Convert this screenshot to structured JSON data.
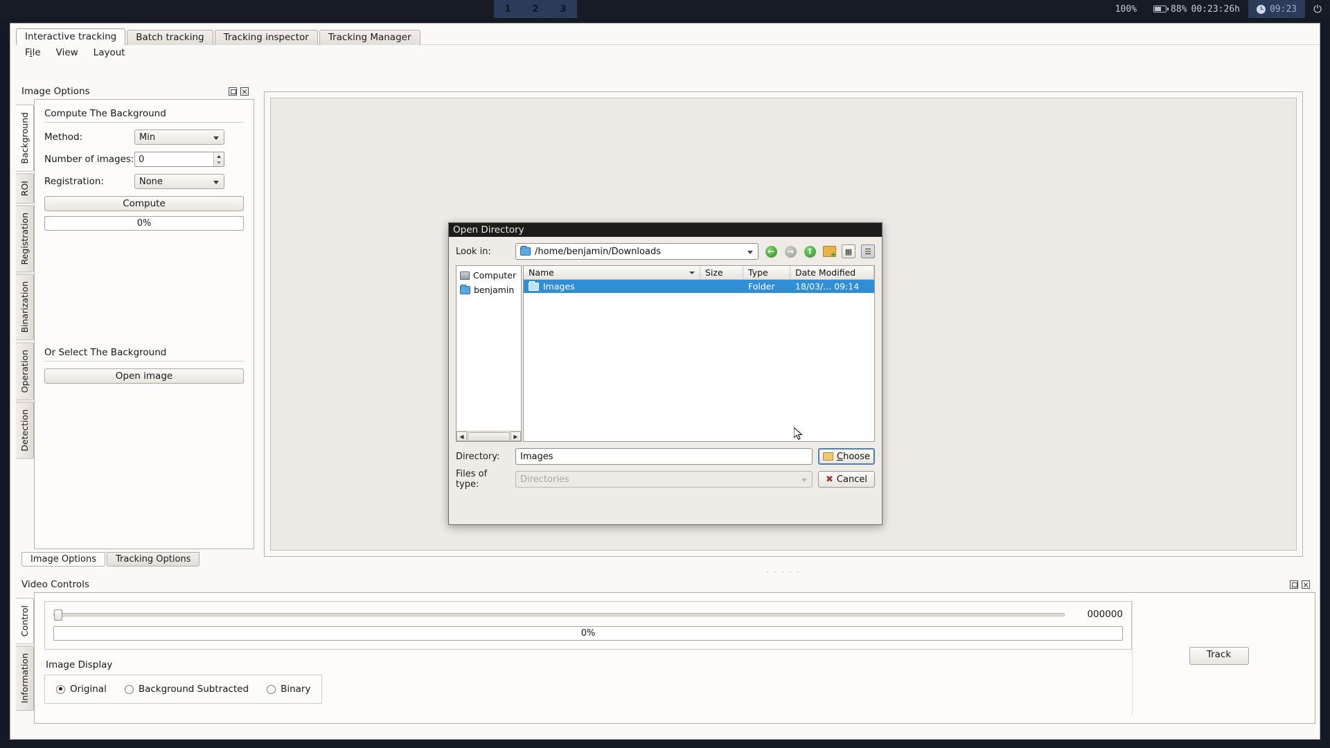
{
  "topbar": {
    "workspaces": [
      "1",
      "2",
      "3"
    ],
    "brightness": "100%",
    "battery_pct": "88%",
    "battery_time": "00:23:26h",
    "clock": "09:23",
    "power_icon": "power-icon"
  },
  "app": {
    "tabs": [
      {
        "label": "Interactive tracking",
        "active": true
      },
      {
        "label": "Batch tracking",
        "active": false
      },
      {
        "label": "Tracking inspector",
        "active": false
      },
      {
        "label": "Tracking Manager",
        "active": false
      }
    ],
    "menu": [
      "File",
      "View",
      "Layout"
    ]
  },
  "image_options": {
    "title": "Image Options",
    "vtabs": [
      {
        "label": "Background",
        "active": true
      },
      {
        "label": "ROI",
        "active": false
      },
      {
        "label": "Registration",
        "active": false
      },
      {
        "label": "Binarization",
        "active": false
      },
      {
        "label": "Operation",
        "active": false
      },
      {
        "label": "Detection",
        "active": false
      }
    ],
    "compute_heading": "Compute The Background",
    "method_label": "Method:",
    "method_value": "Min",
    "num_images_label": "Number of images:",
    "num_images_value": "0",
    "registration_label": "Registration:",
    "registration_value": "None",
    "compute_button": "Compute",
    "progress": "0%",
    "select_heading": "Or Select The Background",
    "open_image_button": "Open image",
    "bottom_tabs": [
      {
        "label": "Image Options",
        "active": true
      },
      {
        "label": "Tracking Options",
        "active": false
      }
    ]
  },
  "video_controls": {
    "title": "Video Controls",
    "vtabs": [
      {
        "label": "Control",
        "active": true
      },
      {
        "label": "Information",
        "active": false
      }
    ],
    "frame_counter": "000000",
    "progress": "0%",
    "image_display_label": "Image Display",
    "display_options": [
      {
        "label": "Original",
        "selected": true
      },
      {
        "label": "Background Subtracted",
        "selected": false
      },
      {
        "label": "Binary",
        "selected": false
      }
    ],
    "track_button": "Track"
  },
  "dialog": {
    "title": "Open Directory",
    "lookin_label": "Look in:",
    "lookin_value": "/home/benjamin/Downloads",
    "nav_icons": [
      "back-icon",
      "forward-icon",
      "parent-directory-icon",
      "new-folder-icon",
      "list-view-icon",
      "detail-view-icon"
    ],
    "sidebar": [
      {
        "label": "Computer",
        "icon": "computer-icon"
      },
      {
        "label": "benjamin",
        "icon": "folder-icon"
      }
    ],
    "columns": [
      "Name",
      "Size",
      "Type",
      "Date Modified"
    ],
    "rows": [
      {
        "name": "Images",
        "size": "",
        "type": "Folder",
        "date": "18/03/... 09:14",
        "selected": true
      }
    ],
    "directory_label": "Directory:",
    "directory_value": "Images",
    "filetype_label": "Files of type:",
    "filetype_value": "Directories",
    "choose_button": "Choose",
    "cancel_button": "Cancel"
  }
}
